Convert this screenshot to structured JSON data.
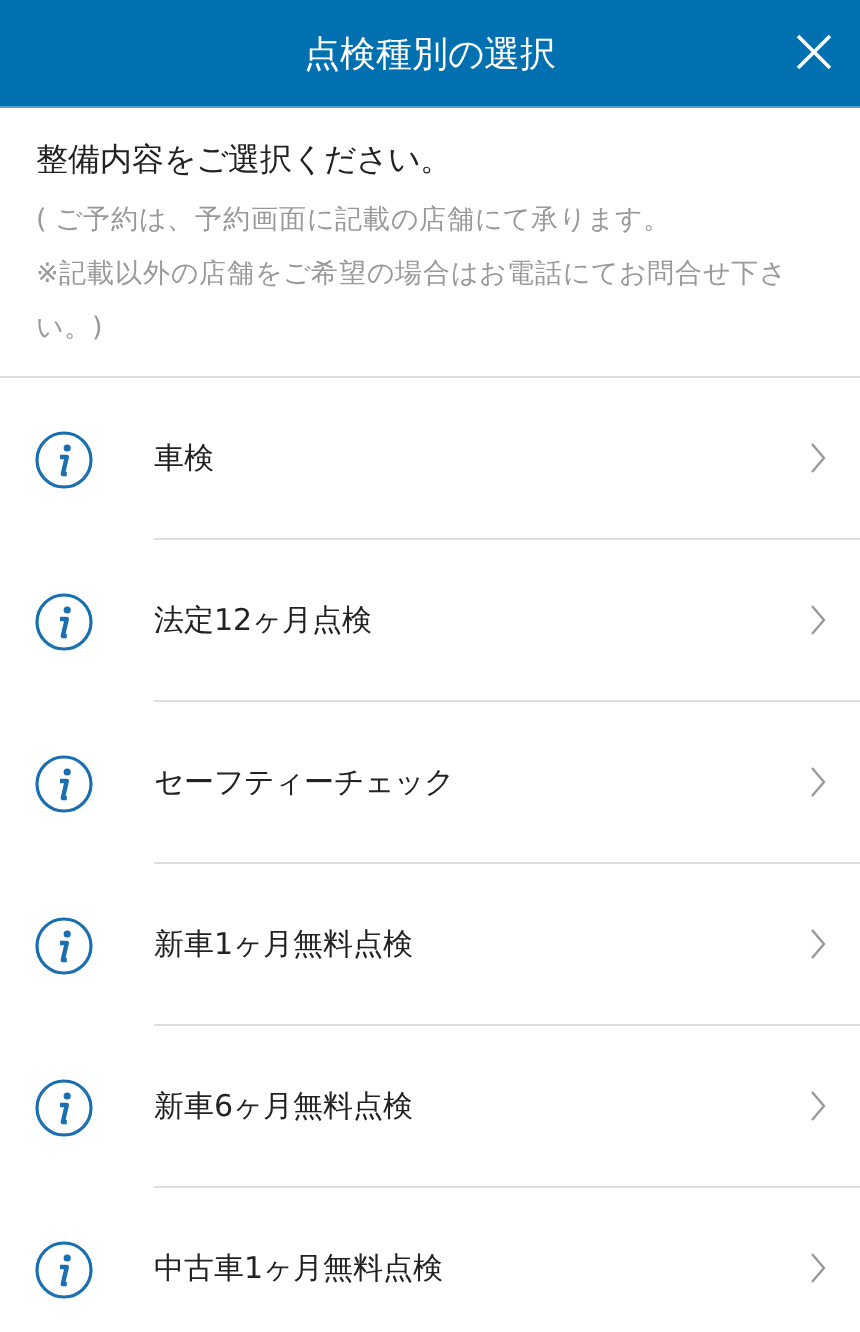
{
  "header": {
    "title": "点検種別の選択"
  },
  "intro": {
    "heading": "整備内容をご選択ください。",
    "notes": [
      "( ご予約は、予約画面に記載の店舗にて承ります。",
      "※記載以外の店舗をご希望の場合はお電話にてお問合せ下さい。)"
    ]
  },
  "items": [
    {
      "label": "車検"
    },
    {
      "label": "法定12ヶ月点検"
    },
    {
      "label": "セーフティーチェック"
    },
    {
      "label": "新車1ヶ月無料点検"
    },
    {
      "label": "新車6ヶ月無料点検"
    },
    {
      "label": "中古車1ヶ月無料点検"
    }
  ]
}
